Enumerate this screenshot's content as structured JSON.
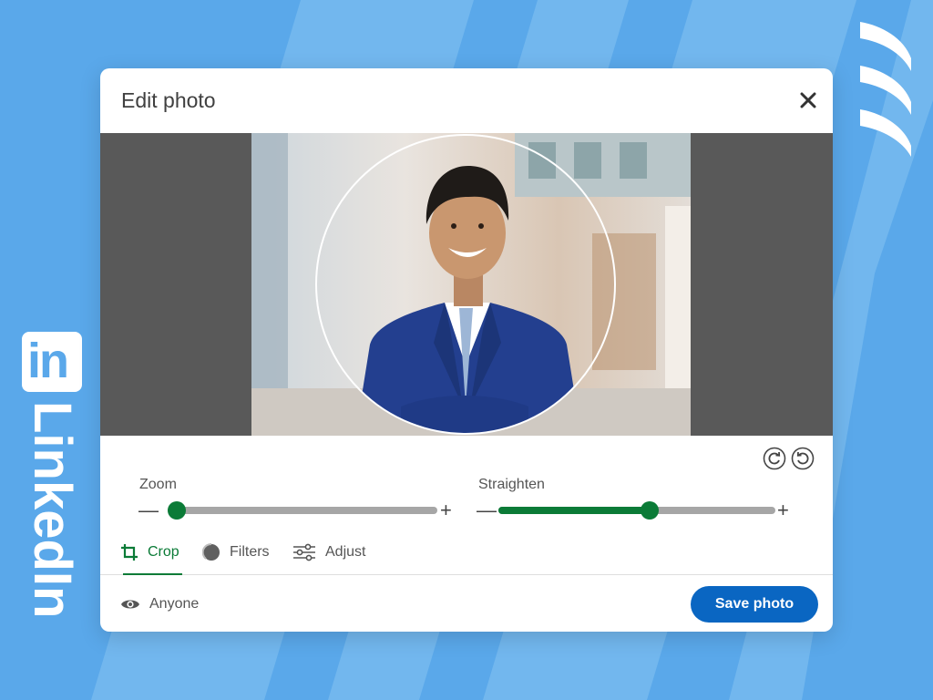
{
  "brand": {
    "logo_box_text": "in",
    "logo_wordmark": "LinkedIn",
    "accent_color": "#0b7b37",
    "primary_button_color": "#0a66c2",
    "background_color": "#5aa8ea"
  },
  "dialog": {
    "title": "Edit photo",
    "close_icon": "close-icon",
    "rotate_icons": [
      "rotate-clockwise-icon",
      "rotate-counterclockwise-icon"
    ]
  },
  "sliders": {
    "zoom": {
      "label": "Zoom",
      "minus": "—",
      "plus": "+",
      "value": 0.0
    },
    "straighten": {
      "label": "Straighten",
      "minus": "—",
      "plus": "+",
      "value": 0.55
    }
  },
  "tabs": [
    {
      "label": "Crop",
      "icon": "crop-icon",
      "active": true
    },
    {
      "label": "Filters",
      "icon": "filters-icon",
      "active": false
    },
    {
      "label": "Adjust",
      "icon": "adjust-sliders-icon",
      "active": false
    }
  ],
  "footer": {
    "visibility_label": "Anyone",
    "visibility_icon": "eye-icon",
    "save_label": "Save photo"
  }
}
